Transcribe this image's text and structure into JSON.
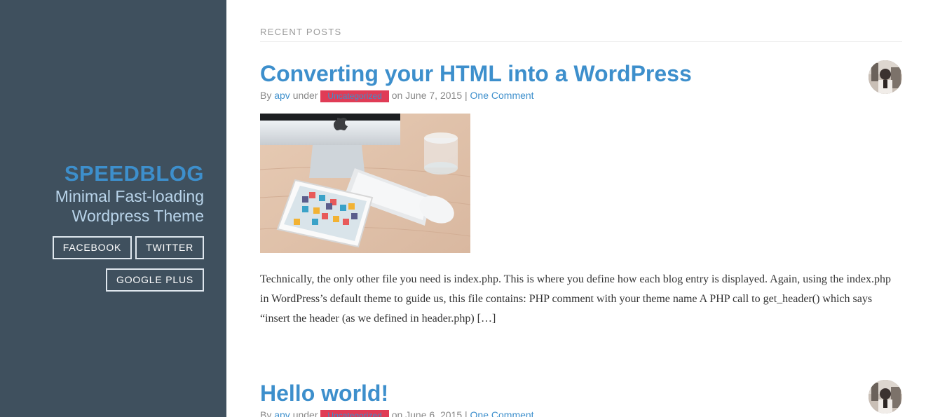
{
  "sidebar": {
    "site_title": "SPEEDBLOG",
    "tagline_line1": "Minimal Fast-loading",
    "tagline_line2": "Wordpress Theme",
    "social": {
      "facebook": "FACEBOOK",
      "twitter": "TWITTER",
      "google_plus": "GOOGLE PLUS"
    }
  },
  "main": {
    "section_label": "RECENT POSTS",
    "posts": [
      {
        "title": "Converting your HTML into a WordPress",
        "by": "By",
        "author": "apv",
        "under": "under",
        "category": "Uncategorized",
        "date": "on June 7, 2015",
        "sep": "|",
        "comments": "One Comment",
        "excerpt": "Technically, the only other file you need is index.php. This is where you define how each blog entry is displayed. Again, using the index.php in WordPress’s default theme to guide us, this file contains: PHP comment with your theme name A PHP call to get_header() which says “insert the header (as we defined in header.php) […]"
      },
      {
        "title": "Hello world!",
        "by": "By",
        "author": "apv",
        "under": "under",
        "category": "Uncategorized",
        "date": "on June 6, 2015",
        "sep": "|",
        "comments": "One Comment"
      }
    ]
  },
  "colors": {
    "sidebar_bg": "#3f505e",
    "accent": "#3d8fcc",
    "badge": "#e03c56"
  }
}
